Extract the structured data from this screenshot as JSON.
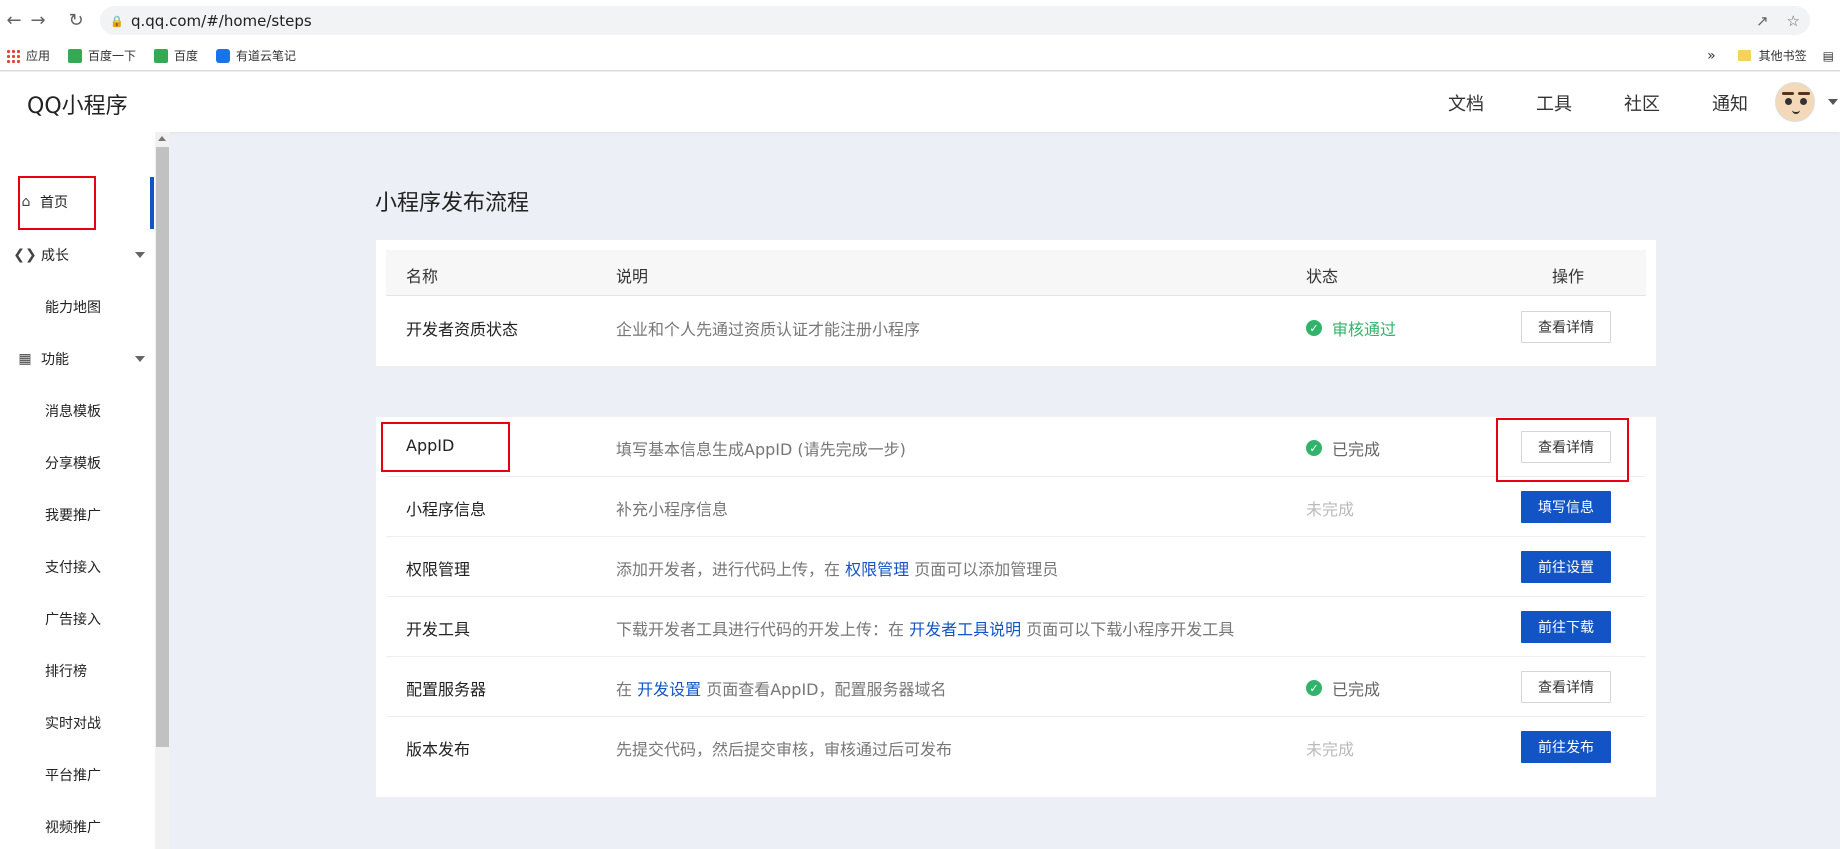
{
  "browser": {
    "url": "q.qq.com/#/home/steps",
    "bookmarks": [
      "应用",
      "百度一下",
      "百度",
      "有道云笔记"
    ],
    "more": "»",
    "other_bookmarks": "其他书签"
  },
  "header": {
    "logo": "QQ小程序",
    "nav": [
      "文档",
      "工具",
      "社区",
      "通知"
    ]
  },
  "sidebar": {
    "items": [
      {
        "label": "首页",
        "icon": "home-icon",
        "active": true
      },
      {
        "label": "成长",
        "icon": "growth-icon",
        "expandable": true
      },
      {
        "label": "能力地图",
        "sub": true
      },
      {
        "label": "功能",
        "icon": "grid-icon",
        "expandable": true
      },
      {
        "label": "消息模板",
        "sub": true
      },
      {
        "label": "分享模板",
        "sub": true
      },
      {
        "label": "我要推广",
        "sub": true
      },
      {
        "label": "支付接入",
        "sub": true
      },
      {
        "label": "广告接入",
        "sub": true
      },
      {
        "label": "排行榜",
        "sub": true
      },
      {
        "label": "实时对战",
        "sub": true
      },
      {
        "label": "平台推广",
        "sub": true
      },
      {
        "label": "视频推广",
        "sub": true
      }
    ]
  },
  "main": {
    "title": "小程序发布流程",
    "columns": {
      "name": "名称",
      "desc": "说明",
      "status": "状态",
      "action": "操作"
    },
    "card1": [
      {
        "name": "开发者资质状态",
        "desc": "企业和个人先通过资质认证才能注册小程序",
        "status": "审核通过",
        "status_type": "pass",
        "button": "查看详情",
        "button_type": "outline"
      }
    ],
    "card2": [
      {
        "name": "AppID",
        "desc": "填写基本信息生成AppID (请先完成一步)",
        "status": "已完成",
        "status_type": "done",
        "button": "查看详情",
        "button_type": "outline"
      },
      {
        "name": "小程序信息",
        "desc": "补充小程序信息",
        "status": "未完成",
        "status_type": "todo",
        "button": "填写信息",
        "button_type": "primary"
      },
      {
        "name": "权限管理",
        "desc_pre": "添加开发者，进行代码上传，在 ",
        "desc_link": "权限管理",
        "desc_post": " 页面可以添加管理员",
        "status": "",
        "status_type": "none",
        "button": "前往设置",
        "button_type": "primary"
      },
      {
        "name": "开发工具",
        "desc_pre": "下载开发者工具进行代码的开发上传：在 ",
        "desc_link": "开发者工具说明",
        "desc_post": " 页面可以下载小程序开发工具",
        "status": "",
        "status_type": "none",
        "button": "前往下载",
        "button_type": "primary"
      },
      {
        "name": "配置服务器",
        "desc_pre": "在 ",
        "desc_link": "开发设置",
        "desc_post": " 页面查看AppID，配置服务器域名",
        "status": "已完成",
        "status_type": "done",
        "button": "查看详情",
        "button_type": "outline"
      },
      {
        "name": "版本发布",
        "desc": "先提交代码，然后提交审核，审核通过后可发布",
        "status": "未完成",
        "status_type": "todo",
        "button": "前往发布",
        "button_type": "primary"
      }
    ]
  }
}
